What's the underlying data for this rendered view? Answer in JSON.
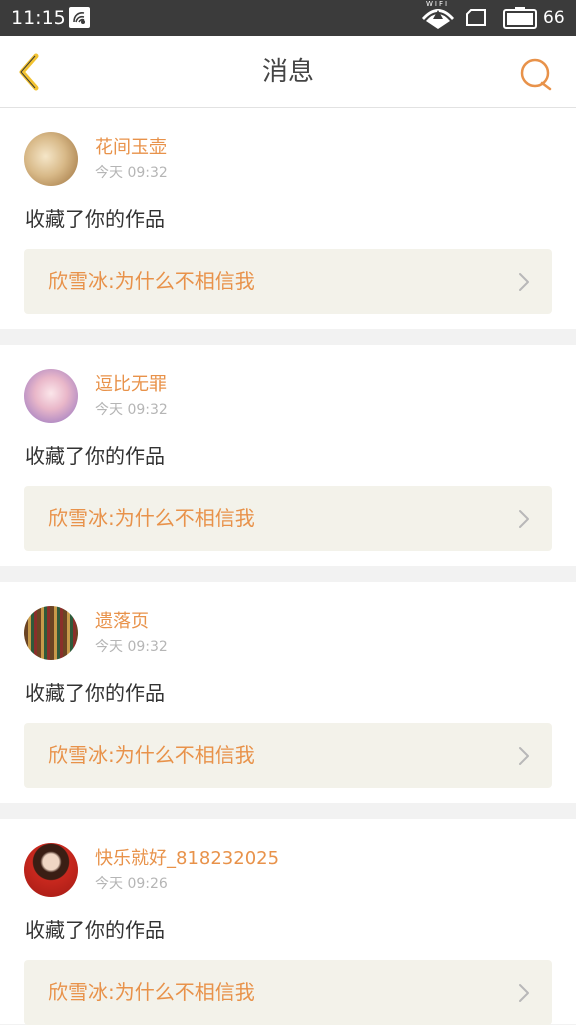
{
  "status_bar": {
    "time": "11:15",
    "wifi_label": "WIFI",
    "battery_level": "66"
  },
  "header": {
    "title": "消息",
    "back_icon": "chevron-left-icon",
    "search_icon": "search-icon"
  },
  "colors": {
    "accent": "#e8924a",
    "back_arrow": "#f2c230",
    "link_bg": "#f3f2ea",
    "separator": "#f2f2f2"
  },
  "messages": [
    {
      "username": "花间玉壶",
      "time": "今天 09:32",
      "action": "收藏了你的作品",
      "work": "欣雪冰:为什么不相信我"
    },
    {
      "username": "逗比无罪",
      "time": "今天 09:32",
      "action": "收藏了你的作品",
      "work": "欣雪冰:为什么不相信我"
    },
    {
      "username": "遗落页",
      "time": "今天 09:32",
      "action": "收藏了你的作品",
      "work": "欣雪冰:为什么不相信我"
    },
    {
      "username": "快乐就好_818232025",
      "time": "今天 09:26",
      "action": "收藏了你的作品",
      "work": "欣雪冰:为什么不相信我"
    }
  ]
}
